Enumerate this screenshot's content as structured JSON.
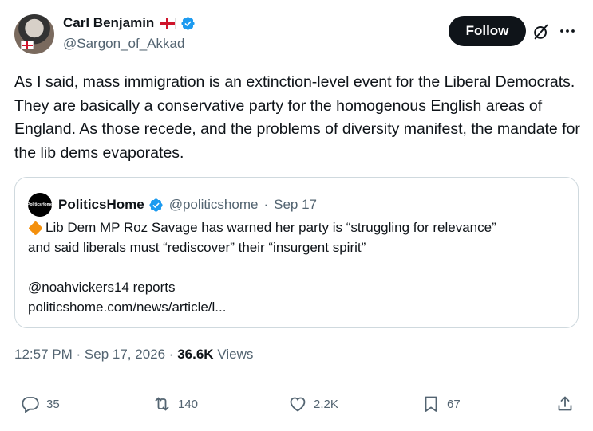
{
  "author": {
    "display_name": "Carl Benjamin",
    "handle": "@Sargon_of_Akkad",
    "follow_label": "Follow"
  },
  "tweet": {
    "text": "As I said, mass immigration is an extinction-level event for the Liberal Democrats. They are basically a conservative party for the homogenous English areas of England. As those recede, and the problems of diversity manifest, the mandate for the lib dems evaporates."
  },
  "quote": {
    "logo_text": "PoliticsHome",
    "display_name": "PoliticsHome",
    "handle": "@politicshome",
    "separator": "·",
    "date": "Sep 17",
    "line1": "Lib Dem MP Roz Savage has warned her party is “struggling for relevance”",
    "line2": "and said liberals must “rediscover” their “insurgent spirit”",
    "line3": "@noahvickers14 reports",
    "line4": "politicshome.com/news/article/l..."
  },
  "meta": {
    "time": "12:57 PM",
    "dot1": "·",
    "date": "Sep 17, 2026",
    "dot2": "·",
    "views_count": "36.6K",
    "views_label": "Views"
  },
  "actions": {
    "replies": "35",
    "reposts": "140",
    "likes": "2.2K",
    "bookmarks": "67"
  },
  "colors": {
    "text": "#0f1419",
    "secondary": "#536471",
    "border": "#cfd9de",
    "verified": "#1d9bf0"
  }
}
